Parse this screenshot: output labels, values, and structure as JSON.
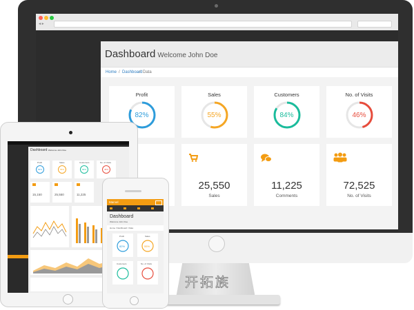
{
  "desktop": {
    "dashboard_title": "Dashboard",
    "welcome": "Welcome John Doe",
    "breadcrumb": [
      "Home",
      "/",
      "Dashboard",
      "/",
      "Data"
    ],
    "stat_cards": [
      {
        "label": "Profit",
        "percent": 82,
        "text": "82%",
        "color": "#2d9cdb"
      },
      {
        "label": "Sales",
        "percent": 55,
        "text": "55%",
        "color": "#f5a623"
      },
      {
        "label": "Customers",
        "percent": 84,
        "text": "84%",
        "color": "#1abc9c"
      },
      {
        "label": "No. of Visits",
        "percent": 46,
        "text": "46%",
        "color": "#e74c3c"
      }
    ],
    "value_cards": [
      {
        "value": "",
        "label": "",
        "icon": "card-icon"
      },
      {
        "value": "25,550",
        "label": "Sales",
        "icon": "cart-icon"
      },
      {
        "value": "11,225",
        "label": "Comments",
        "icon": "comments-icon"
      },
      {
        "value": "72,525",
        "label": "No. of Visits",
        "icon": "users-icon"
      }
    ]
  },
  "tablet": {
    "dashboard_title": "Dashboard",
    "welcome": "Welcome John Doe",
    "stat_cards": [
      {
        "label": "Profit",
        "text": "82%",
        "color": "#2d9cdb"
      },
      {
        "label": "Sales",
        "text": "55%",
        "color": "#f5a623"
      },
      {
        "label": "Customers",
        "text": "84%",
        "color": "#1abc9c"
      },
      {
        "label": "No. of Visits",
        "text": "46%",
        "color": "#e74c3c"
      }
    ],
    "value_cards": [
      {
        "value": "15,150"
      },
      {
        "value": "25,550"
      },
      {
        "value": "11,225"
      }
    ]
  },
  "phone": {
    "brand": "Marvel",
    "dashboard_title": "Dashboard",
    "welcome": "Welcome John Doe",
    "breadcrumb": "Home / Dashboard / Data",
    "stat_cards": [
      {
        "label": "Profit",
        "text": "82%",
        "color": "#2d9cdb"
      },
      {
        "label": "Sales",
        "text": "55%",
        "color": "#f5a623"
      },
      {
        "label": "Customers",
        "text": "",
        "color": "#1abc9c"
      },
      {
        "label": "No. of Visits",
        "text": "",
        "color": "#e74c3c"
      }
    ]
  },
  "watermark": "开拓族",
  "colors": {
    "accent_orange": "#f39c12",
    "monitor_bezel": "#2f2f2f",
    "sidebar_dark": "#2c2c2c"
  }
}
